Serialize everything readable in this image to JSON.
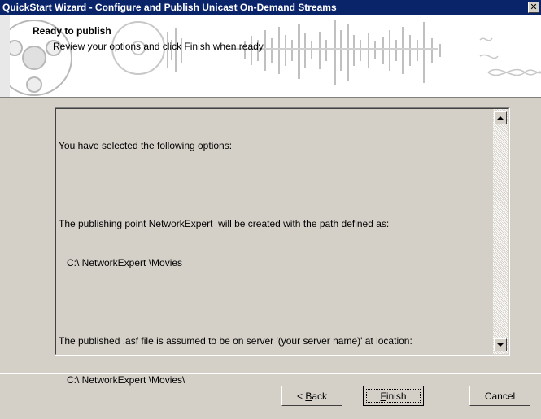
{
  "window": {
    "title": "QuickStart Wizard - Configure and Publish Unicast On-Demand Streams",
    "close_glyph": "✕"
  },
  "header": {
    "title": "Ready to publish",
    "subtitle": "Review your options and click Finish when ready."
  },
  "summary": {
    "lines": [
      "You have selected the following options:",
      "",
      "The publishing point NetworkExpert  will be created with the path defined as:",
      "   C:\\ NetworkExpert \\Movies",
      "",
      "The published .asf file is assumed to be on server '(your server name)' at location:",
      "   C:\\ NetworkExpert \\Movies\\"
    ]
  },
  "buttons": {
    "back": {
      "prefix": "< ",
      "mnemonic": "B",
      "rest": "ack"
    },
    "finish": {
      "mnemonic": "F",
      "rest": "inish"
    },
    "cancel": "Cancel"
  },
  "colors": {
    "titlebar": "#0a246a",
    "face": "#d4d0c8"
  }
}
